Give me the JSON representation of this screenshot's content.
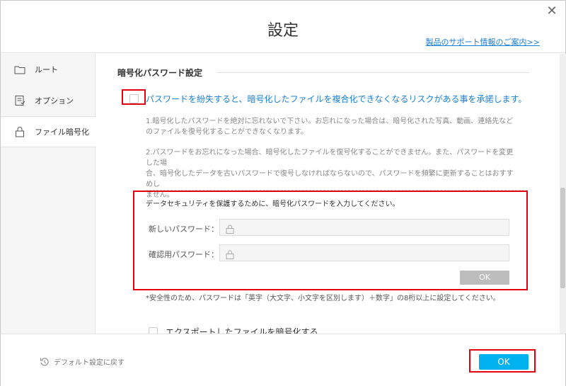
{
  "window": {
    "title": "設定",
    "close_icon": "close-icon"
  },
  "header": {
    "support_link": "製品のサポート情報のご案内>>"
  },
  "sidebar": {
    "items": [
      {
        "label": "ルート",
        "icon": "folder-icon"
      },
      {
        "label": "オプション",
        "icon": "options-icon"
      },
      {
        "label": "ファイル暗号化",
        "icon": "lock-icon",
        "active": true
      }
    ]
  },
  "content": {
    "section_title": "暗号化パスワード設定",
    "consent_text": "パスワードを紛失すると、暗号化したファイルを複合化できなくなるリスクがある事を承諾します。",
    "note1_line1": "1.暗号化したパスワードを絶対に忘れないで下さい。お忘れになった場合は、暗号化された写真、動画、連絡先など",
    "note1_line2": "のファイルを復号化することができなくなります。",
    "note2_line1": "2.パスワードをお忘れになった場合、暗号化したファイルを復号化することができません。また、パスワードを変更した場",
    "note2_line2": "合、暗号化したデータを古いパスワードで復号しなければならないので、パスワードを頻繁に更新することはおすすめし",
    "note2_line3": "ません。",
    "password_prompt": "データセキュリティを保護するために、暗号化パスワードを入力してください。",
    "new_password_label": "新しいパスワード：",
    "new_password_value": "",
    "confirm_password_label": "確認用パスワード：",
    "confirm_password_value": "",
    "ok_label": "OK",
    "hint": "*安全性のため、パスワードは「英字（大文字、小文字を区別します）＋数字」の8桁以上に設定してください。",
    "export_label": "エクスポートしたファイルを暗号化する"
  },
  "footer": {
    "reset_label": "デフォルト設定に戻す",
    "ok_label": "OK"
  },
  "colors": {
    "accent": "#00b2ef",
    "link": "#1a7fd4",
    "highlight": "#e3000f"
  }
}
